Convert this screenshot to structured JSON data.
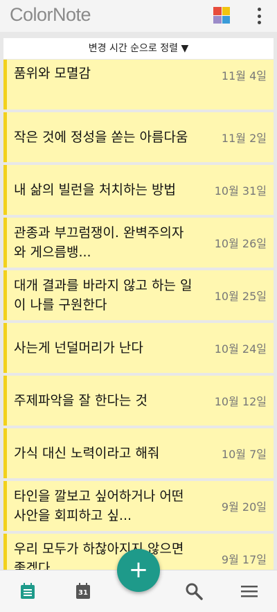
{
  "app": {
    "logo": "ColorNote"
  },
  "header": {
    "grid_icon": "color-grid-icon",
    "more_icon": "more-vert-icon"
  },
  "sort": {
    "label": "변경 시간 순으로 정렬 ▼"
  },
  "notes": [
    {
      "title": "품위와 모멸감",
      "date": "11월 4일"
    },
    {
      "title": "작은 것에 정성을 쏟는 아름다움",
      "date": "11월 2일"
    },
    {
      "title": "내 삶의 빌런을 처치하는 방법",
      "date": "10월 31일"
    },
    {
      "title": "관종과 부끄럼쟁이. 완벽주의자와 게으름뱅...",
      "date": "10월 26일"
    },
    {
      "title": "대개 결과를 바라지 않고 하는 일이 나를 구원한다",
      "date": "10월 25일"
    },
    {
      "title": "사는게 넌덜머리가 난다",
      "date": "10월 24일"
    },
    {
      "title": "주제파악을 잘 한다는 것",
      "date": "10월 12일"
    },
    {
      "title": "가식 대신 노력이라고 해줘",
      "date": "10월 7일"
    },
    {
      "title": "타인을 깔보고 싶어하거나 어떤 사안을 회피하고 싶...",
      "date": "9월 20일"
    },
    {
      "title": "우리 모두가 하찮아지지 않으면 좋겠다",
      "date": "9월 17일"
    }
  ],
  "fab": {
    "label": "+"
  },
  "bottom_nav": {
    "calendar_day": "31"
  },
  "colors": {
    "note_bg": "#fff7b0",
    "note_stripe": "#f2d11c",
    "accent": "#1e9a8a"
  }
}
